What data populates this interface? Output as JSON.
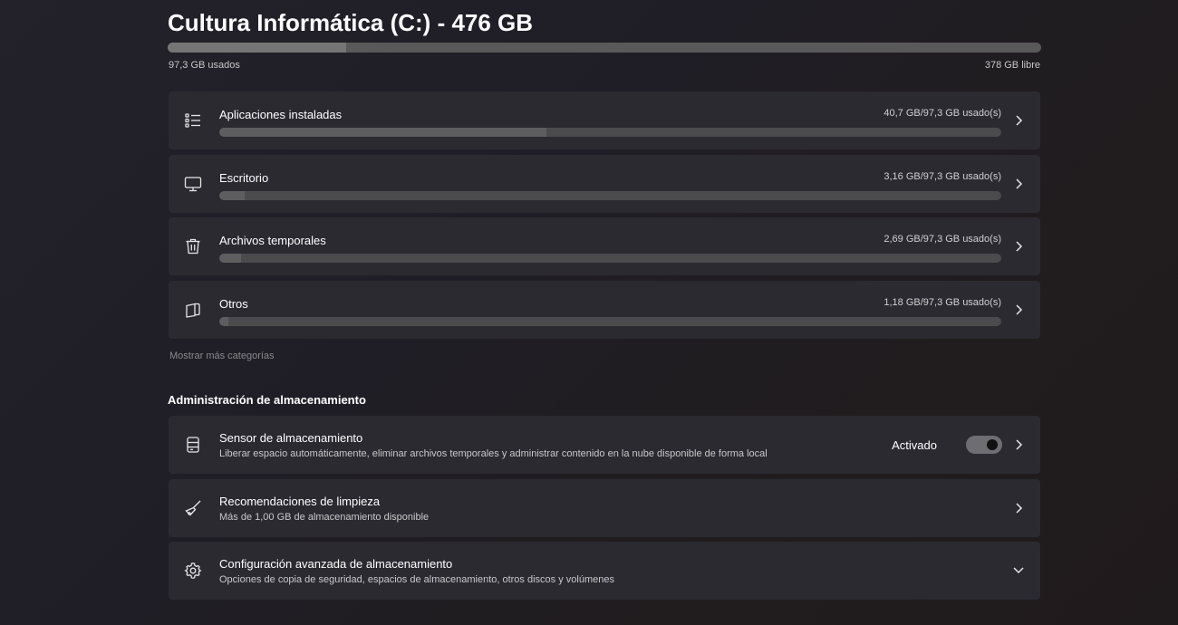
{
  "drive": {
    "title": "Cultura Informática (C:) - 476 GB",
    "used_label": "97,3 GB usados",
    "free_label": "378 GB libre",
    "used_fraction": 0.204
  },
  "categories": [
    {
      "label": "Aplicaciones instaladas",
      "amount": "40,7 GB/97,3 GB usado(s)",
      "fraction": 0.418,
      "icon": "list-icon"
    },
    {
      "label": "Escritorio",
      "amount": "3,16 GB/97,3 GB usado(s)",
      "fraction": 0.032,
      "icon": "monitor-icon"
    },
    {
      "label": "Archivos temporales",
      "amount": "2,69 GB/97,3 GB usado(s)",
      "fraction": 0.028,
      "icon": "trash-icon"
    },
    {
      "label": "Otros",
      "amount": "1,18 GB/97,3 GB usado(s)",
      "fraction": 0.012,
      "icon": "document-icon"
    }
  ],
  "more_categories": "Mostrar más categorías",
  "management": {
    "title": "Administración de almacenamiento",
    "items": [
      {
        "title": "Sensor de almacenamiento",
        "description": "Liberar espacio automáticamente, eliminar archivos temporales y administrar contenido en la nube disponible de forma local",
        "toggle_label": "Activado",
        "toggle_on": true,
        "icon": "storage-drive-icon"
      },
      {
        "title": "Recomendaciones de limpieza",
        "description": "Más de 1,00 GB de almacenamiento disponible",
        "icon": "broom-icon"
      },
      {
        "title": "Configuración avanzada de almacenamiento",
        "description": "Opciones de copia de seguridad, espacios de almacenamiento, otros discos y volúmenes",
        "icon": "gear-icon"
      }
    ]
  },
  "colors": {
    "background": "#211f26",
    "card": "#2b2a31",
    "bar_track": "#4b4b4d",
    "bar_fill": "#5e5e60",
    "toggle_on": "#6e6d72"
  }
}
